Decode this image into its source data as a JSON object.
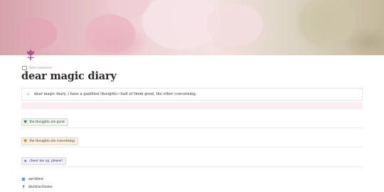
{
  "page": {
    "title": "dear magic diary",
    "add_comment": "Add comment"
  },
  "callout": {
    "text": "dear magic diary, i have a gazillion thoughts—half of them good, the other concerning."
  },
  "buttons": [
    {
      "label": "the thoughts are good",
      "icon": "heart-icon",
      "color": "#3d8a5f",
      "bg": "#eef5ee"
    },
    {
      "label": "the thoughts are concerning",
      "icon": "heart-icon",
      "color": "#c68a2a",
      "bg": "#fbf0de"
    },
    {
      "label": "cheer me up, please!",
      "icon": "star-icon",
      "color": "#7a5ac8",
      "bg": "#f2eefb"
    }
  ],
  "links": [
    {
      "label": "archive",
      "icon": "archive-box-icon",
      "color": "#5b8fc7"
    },
    {
      "label": "instructions",
      "icon": "flower-icon",
      "color": "#c0607e"
    }
  ],
  "colors": {
    "accent": "#c0607e",
    "callout_bg": "#fbeef2"
  }
}
